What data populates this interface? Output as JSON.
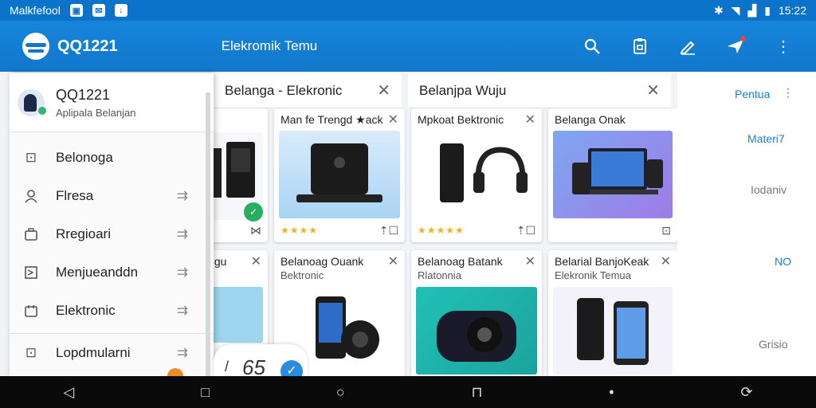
{
  "status_bar": {
    "carrier": "Malkfefool",
    "time": "15:22",
    "left_icons": [
      "gallery-icon",
      "mail-icon",
      "download-icon"
    ],
    "right_icons": [
      "bluetooth-icon",
      "wifi-icon",
      "signal-icon",
      "battery-icon"
    ]
  },
  "app_bar": {
    "app_name": "QQ1221",
    "page_title": "Elekromik Temu",
    "actions": [
      "search-icon",
      "clipboard-icon",
      "edit-icon",
      "send-icon",
      "more-icon"
    ],
    "accent": "#1278cc"
  },
  "drawer": {
    "header_name": "QQ1221",
    "header_sub": "Aplipala Belanjan",
    "items": [
      {
        "icon": "list-icon",
        "label": "Belonoga"
      },
      {
        "icon": "person-icon",
        "label": "Flresa"
      },
      {
        "icon": "briefcase-icon",
        "label": "Rregioari"
      },
      {
        "icon": "tag-icon",
        "label": "Menjueanddn"
      },
      {
        "icon": "calendar-icon",
        "label": "Elektronic"
      },
      {
        "icon": "grid-icon",
        "label": "Lopdmularni"
      }
    ]
  },
  "tabs": [
    {
      "title": "Belanga - Elekronic"
    },
    {
      "title": "Belanjpa  Wuju"
    }
  ],
  "cards": [
    {
      "title": "Man fe Trengd ★ack",
      "sub": "",
      "rating": "★★★★",
      "image": "speakers"
    },
    {
      "title": "Mpkoat Bektronic",
      "sub": "",
      "rating": "★★★★★",
      "image": "headphones"
    },
    {
      "title": "Belanga Onak",
      "sub": "",
      "rating": "",
      "image": "devices"
    },
    {
      "title": "Belanoag Ouank",
      "sub": "Bektronic",
      "rating": "",
      "image": "phone-speaker"
    },
    {
      "title": "Belanoag Batank",
      "sub": "Rlatonnia",
      "rating": "",
      "image": "subwoofer"
    },
    {
      "title": "Belarial BanjoKeak",
      "sub": "Elekronik Temua",
      "rating": "",
      "image": "phones"
    },
    {
      "title": "nigu",
      "sub": "",
      "rating": "",
      "image": "room"
    }
  ],
  "rail": {
    "items": [
      "Pentua",
      "Materi7",
      "Iodaniv",
      "NO",
      "Grisio"
    ]
  },
  "bubble": {
    "number": "65"
  }
}
